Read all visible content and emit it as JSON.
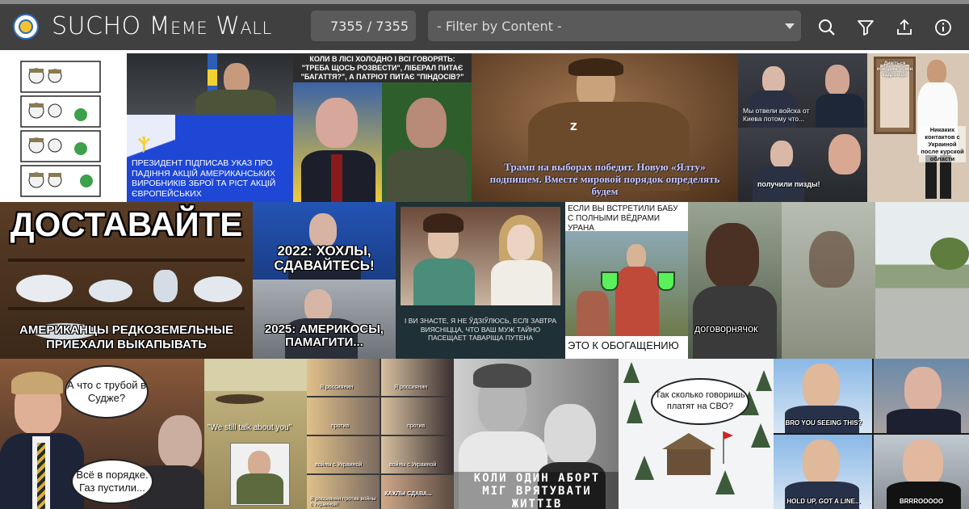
{
  "app": {
    "title": "SUCHO Meme Wall",
    "counter": "7355 / 7355",
    "filter_placeholder": "- Filter by Content -"
  },
  "toolbar": {
    "icons": [
      "search-icon",
      "filter-icon",
      "upload-icon",
      "info-icon"
    ]
  },
  "tiles": {
    "zelensky_decree": "ПРЕЗИДЕНТ ПІДПИСАВ УКАЗ ПРО ПАДІННЯ АКЦІЙ АМЕРИКАНСЬКИХ ВИРОБНИКІВ ЗБРОЇ ТА РІСТ АКЦІЙ ЄВРОПЕЙСЬКИХ",
    "poroshenko_top": "КОЛИ В ЛІСІ ХОЛОДНО І ВСІ ГОВОРЯТЬ: \"ТРЕБА ЩОСЬ РОЗВЕСТИ\", ЛІБЕРАЛ ПИТАЄ \"БАГАТТЯ?\", А ПАТРІОТ ПИТАЄ \"ПІНДОСІВ?\"",
    "trump_caption": "Трамп на выборах победит. Новую «Ялту» подпишем. Вместе мировой порядок определять будем",
    "putin_van_1": "Мы отвели войска от Киева потому что...",
    "putin_van_2": "получили пизды!",
    "mirror_1": "Дивіться обходим обмін кадровців",
    "mirror_2": "Никаких контактов с Украиной после курской области",
    "dostavaite_top": "ДОСТАВАЙТЕ",
    "dostavaite_bottom": "АМЕРИКАНЦЫ РЕДКОЗЕМЕЛЬНЫЕ ПРИЕХАЛИ ВЫКАПЫВАТЬ",
    "putin_2022": "2022: ХОХЛЫ, СДАВАЙТЕСЬ!",
    "putin_2025": "2025: АМЕРИКОСЫ, ПАМАГИТИ...",
    "ladies_caption": "І ВИ ЗНАСТЕ, Я НЕ ЎДЗІЎЛЮСЬ, ЕСЛІ ЗАВТРА ВИЯСНІЦЦА, ЧТО ВАШ МУЖ ТАЙНО ПАСЕЩАЕТ ТАВАРІЩА ПУТЕНА",
    "baba_top": "ЕСЛИ ВЫ ВСТРЕТИЛИ БАБУ С ПОЛНЫМИ ВЁДРАМИ УРАНА",
    "baba_bottom": "ЭТО К ОБОГАЩЕНИЮ",
    "dogovor": "договорнячок",
    "tucker_1": "А что с трубой в Судже?",
    "tucker_2": "Всё в порядке. Газ пустили...",
    "still_talk": "\"We still talk about you\"",
    "grid_a": "Я россиянин",
    "grid_b": "против",
    "grid_c": "войны с Украиной",
    "grid_d": "Я россиянин против войны с Украиной!",
    "grid_e": "ХАХЛЫ СДАВА...",
    "abortion": "КОЛИ ОДИН АБОРТ МІГ ВРЯТУВАТИ ЖИТТІВ",
    "svo_bubble": "Так сколько говоришь платят на СВО?",
    "xi_1": "BRO YOU SEEING THIS?",
    "xi_2": "HOLD UP, GOT A LINE...",
    "kim": "BRRROOOOO"
  },
  "colors": {
    "header_bg": "#404040",
    "input_bg": "#5a5a5a",
    "accent_blue": "#1f47d6"
  }
}
